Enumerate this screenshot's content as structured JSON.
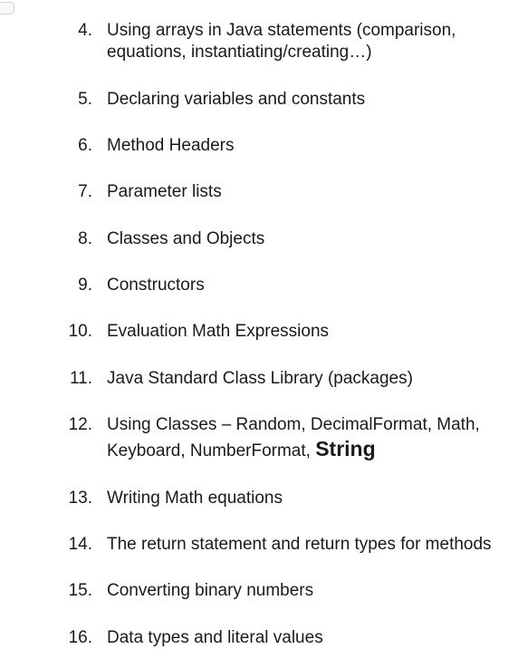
{
  "list": {
    "start": 4,
    "items": [
      {
        "html": "Using arrays in Java statements (comparison, equations, instantiating/creating…)"
      },
      {
        "html": "Declaring variables and constants"
      },
      {
        "html": "Method Headers"
      },
      {
        "html": "Parameter lists"
      },
      {
        "html": "Classes and Objects"
      },
      {
        "html": "Constructors"
      },
      {
        "html": "Evaluation Math Expressions"
      },
      {
        "html": "Java Standard Class Library (packages)"
      },
      {
        "html": "Using Classes – Random, DecimalFormat, Math, Keyboard, NumberFormat, <span class=\"em\">String</span>"
      },
      {
        "html": "Writing Math equations"
      },
      {
        "html": "The return statement and return types for methods"
      },
      {
        "html": "Converting binary numbers"
      },
      {
        "html": "Data types and literal values"
      }
    ]
  }
}
